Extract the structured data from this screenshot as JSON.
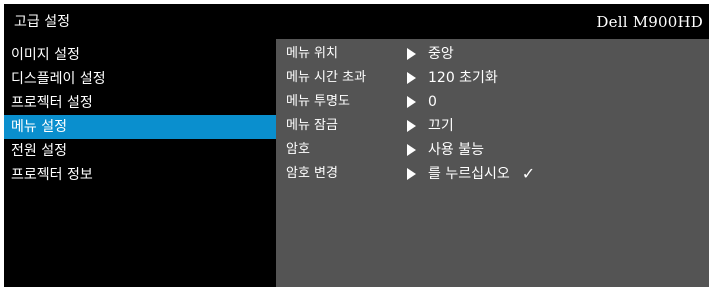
{
  "header": {
    "title": "고급 설정",
    "brand": "Dell  M900HD"
  },
  "sidebar": {
    "items": [
      {
        "label": "이미지 설정"
      },
      {
        "label": "디스플레이 설정"
      },
      {
        "label": "프로젝터 설정"
      },
      {
        "label": "메뉴 설정",
        "selected": true
      },
      {
        "label": "전원 설정"
      },
      {
        "label": "프로젝터 정보"
      }
    ]
  },
  "menu_settings": {
    "rows": [
      {
        "label": "메뉴 위치",
        "value": "중앙"
      },
      {
        "label": "메뉴 시간 초과",
        "value": "120  초기화"
      },
      {
        "label": "메뉴 투명도",
        "value": "0"
      },
      {
        "label": "메뉴 잠금",
        "value": "끄기"
      },
      {
        "label": "암호",
        "value": "사용 불능"
      },
      {
        "label": "암호 변경",
        "value": "를 누르십시오",
        "check": "✓"
      }
    ]
  },
  "colors": {
    "titlebar_bg": "#000000",
    "sidebar_bg": "#000000",
    "content_bg": "#545454",
    "selected_bg": "#0a8fce",
    "text": "#ffffff"
  },
  "icons": {
    "row_arrow": "right-triangle-icon",
    "checkmark": "check-icon"
  }
}
